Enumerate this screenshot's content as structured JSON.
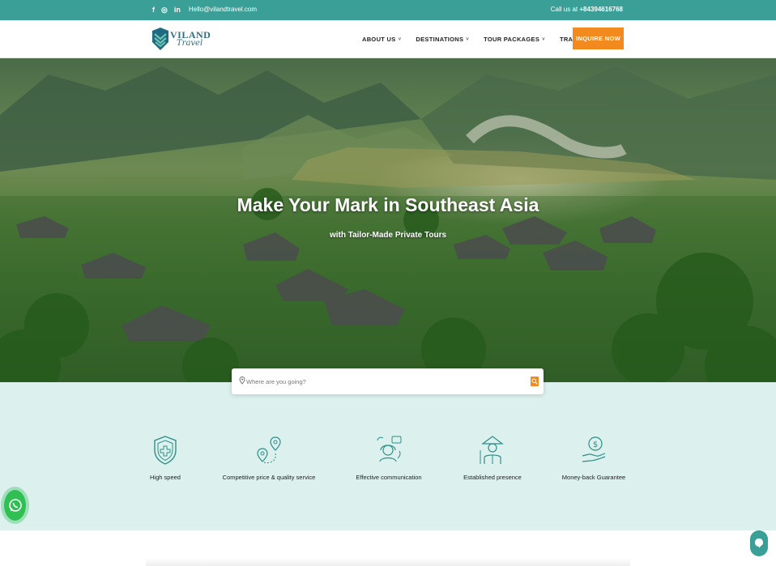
{
  "topbar": {
    "social": [
      {
        "icon": "facebook-icon",
        "glyph": "f"
      },
      {
        "icon": "instagram-icon",
        "glyph": "◎"
      },
      {
        "icon": "linkedin-icon",
        "glyph": "in"
      }
    ],
    "email": "Hello@vilandtravel.com",
    "phone_prefix": "Call us at",
    "phone": "+84394616768",
    "background": "#3a9f96"
  },
  "header": {
    "logo_word": "VILAND",
    "logo_word2": "Travel",
    "nav": [
      {
        "label": "ABOUT US",
        "caret": "˅"
      },
      {
        "label": "DESTINATIONS",
        "caret": "˅"
      },
      {
        "label": "TOUR PACKAGES",
        "caret": "˅"
      },
      {
        "label": "TRAVEL BLOG",
        "caret": ""
      }
    ],
    "cta": "INQUIRE NOW",
    "cta_color": "#f28a1d"
  },
  "hero": {
    "title": "Make Your Mark in Southeast Asia",
    "subtitle": "with Tailor-Made Private Tours"
  },
  "search": {
    "placeholder": "Where are you going?",
    "icon": "search-icon",
    "pin_icon": "map-pin-icon"
  },
  "features": [
    {
      "label": "High speed",
      "icon": "shield-plus-icon"
    },
    {
      "label": "Competitive price & quality service",
      "icon": "map-route-icon"
    },
    {
      "label": "Effective communication",
      "icon": "support-agent-icon"
    },
    {
      "label": "Established presence",
      "icon": "farmer-icon"
    },
    {
      "label": "Money-back Guarantee",
      "icon": "money-hand-icon"
    }
  ],
  "floating": {
    "whatsapp_icon": "whatsapp-icon",
    "chat_icon": "chat-icon"
  }
}
